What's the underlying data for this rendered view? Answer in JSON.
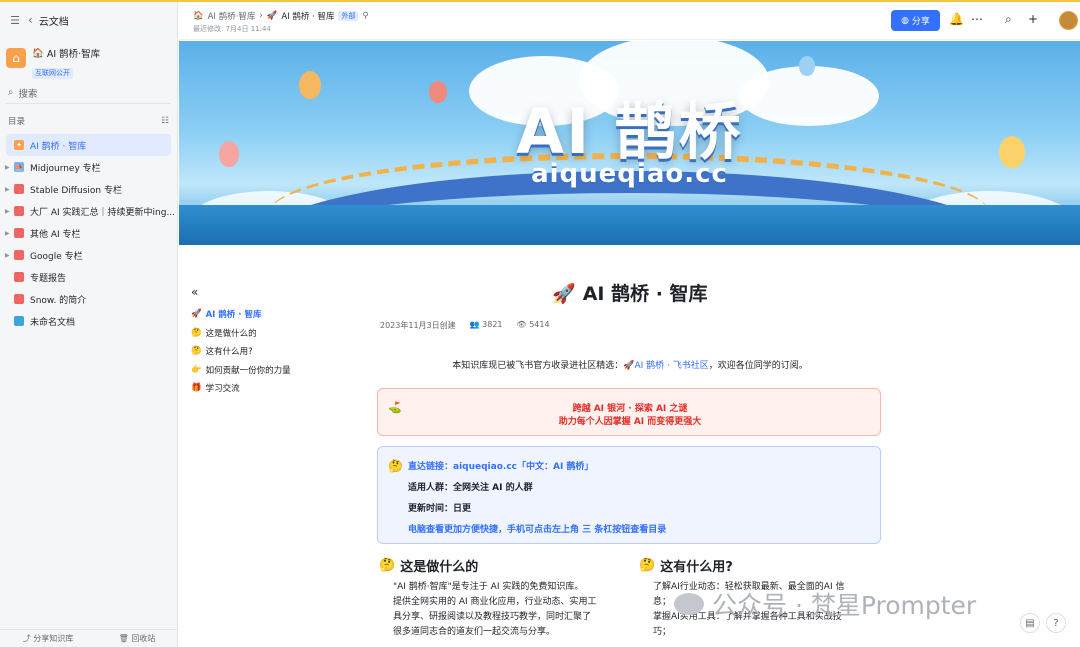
{
  "sidebar": {
    "top_title": "云文档",
    "space_title": "AI 鹊桥·智库",
    "space_badge": "互联网公开",
    "search_placeholder": "搜索",
    "toc_label": "目录",
    "items": [
      {
        "label": "AI 鹊桥 · 智库",
        "active": true,
        "color": "#f8a04a"
      },
      {
        "label": "Midjourney 专栏",
        "active": false,
        "color": "#7bb0e8"
      },
      {
        "label": "Stable Diffusion 专栏",
        "active": false,
        "color": "#f06565"
      },
      {
        "label": "大厂 AI 实践汇总｜持续更新中ing...",
        "active": false,
        "color": "#f06565"
      },
      {
        "label": "其他 AI 专栏",
        "active": false,
        "color": "#f06565"
      },
      {
        "label": "Google 专栏",
        "active": false,
        "color": "#f06565"
      },
      {
        "label": "专题报告",
        "active": false,
        "color": "#f06565"
      },
      {
        "label": "Snow. 的简介",
        "active": false,
        "color": "#f06565"
      },
      {
        "label": "未命名文档",
        "active": false,
        "color": "#3aa5d8"
      }
    ],
    "bottom": [
      "分享知识库",
      "回收站"
    ]
  },
  "header": {
    "crumb_root": "AI 鹊桥·智库",
    "crumb_current": "AI 鹊桥 · 智库",
    "crumb_tag": "外部",
    "last_edited": "最近修改: 7月4日 11:44",
    "share_label": "分享"
  },
  "banner": {
    "title": "AI 鹊桥",
    "subtitle": "aiqueqiao.cc"
  },
  "toc": [
    {
      "label": "AI 鹊桥 · 智库",
      "active": true
    },
    {
      "label": "这是做什么的",
      "active": false
    },
    {
      "label": "这有什么用?",
      "active": false
    },
    {
      "label": "如何贡献一份你的力量",
      "active": false
    },
    {
      "label": "学习交流",
      "active": false
    }
  ],
  "doc": {
    "title": "AI 鹊桥 · 智库",
    "created": "2023年11月3日创建",
    "collaborators": "3821",
    "views": "5414",
    "intro_prefix": "本知识库现已被飞书官方收录进社区精选：",
    "intro_link": "AI 鹊桥 · 飞书社区",
    "intro_suffix": "，欢迎各位同学的订阅。",
    "red_line1": "跨越 AI 银河 · 探索 AI 之谜",
    "red_line2": "助力每个人因掌握 AI 而变得更强大",
    "blue_lines": [
      "直达链接：aiqueqiao.cc「中文：AI 鹊桥」",
      "适用人群：全网关注 AI 的人群",
      "更新时间：日更",
      "电脑查看更加方便快捷，手机可点击左上角 三 条杠按钮查看目录"
    ],
    "sec1_title": "这是做什么的",
    "sec1_lines": [
      "\"AI 鹊桥·智库\"是专注于 AI 实践的免费知识库。",
      "提供全网实用的 AI 商业化应用，行业动态、实用工",
      "具分享、研报阅读以及教程技巧教学，同时汇聚了",
      "很多道同志合的道友们一起交流与分享。"
    ],
    "sec2_title": "这有什么用?",
    "sec2_lines": [
      "了解AI行业动态：轻松获取最新、最全面的AI 信",
      "息；",
      "掌握AI实用工具：了解并掌握各种工具和实战技",
      "巧；"
    ]
  },
  "watermark": "公众号 · 梵星Prompter"
}
